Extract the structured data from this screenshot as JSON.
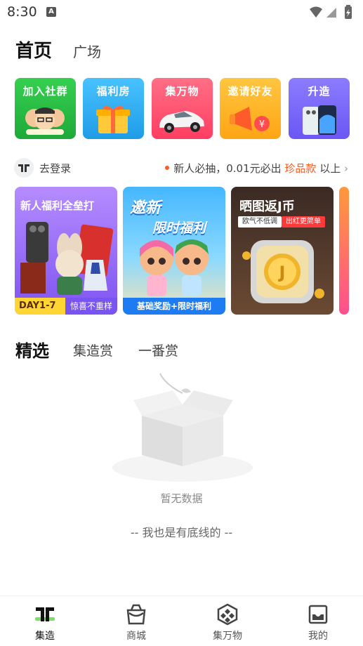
{
  "status_bar": {
    "time": "8:30",
    "notification_icon": "A"
  },
  "top_tabs": [
    {
      "label": "首页",
      "active": true
    },
    {
      "label": "广场",
      "active": false
    }
  ],
  "quick_entries": [
    {
      "label": "加入社群",
      "icon": "people-group-icon",
      "color": "#2fc24a"
    },
    {
      "label": "福利房",
      "icon": "gift-box-icon",
      "color": "#34b0f2"
    },
    {
      "label": "集万物",
      "icon": "sports-car-icon",
      "color": "#ff4f6e"
    },
    {
      "label": "邀请好友",
      "icon": "megaphone-icon",
      "color": "#ffb21f"
    },
    {
      "label": "升造",
      "icon": "phone-icon",
      "color": "#7b6bff"
    }
  ],
  "login_row": {
    "login_text": "去登录",
    "notice_prefix": "新人必抽，0.01元必出",
    "notice_highlight": "珍品款",
    "notice_suffix": "以上"
  },
  "banners": [
    {
      "title": "新人福利全垒打",
      "tag_left": "DAY1-7",
      "tag_right": "惊喜不重样"
    },
    {
      "title": "邀新",
      "subtitle": "限时福利",
      "caption": "基础奖励+限时福利"
    },
    {
      "title": "晒图返J币",
      "pill_left": "欧气不低调",
      "pill_right": "出红更简单"
    }
  ],
  "section_tabs": [
    {
      "label": "精选",
      "active": true
    },
    {
      "label": "集造赏",
      "active": false
    },
    {
      "label": "一番赏",
      "active": false
    }
  ],
  "empty_state": {
    "text": "暂无数据",
    "bottom_line": "-- 我也是有底线的 --"
  },
  "bottom_nav": [
    {
      "label": "集造",
      "icon": "jizao-logo-icon",
      "active": true
    },
    {
      "label": "商城",
      "icon": "shopping-bag-icon",
      "active": false
    },
    {
      "label": "集万物",
      "icon": "diamond-pattern-icon",
      "active": false
    },
    {
      "label": "我的",
      "icon": "profile-tray-icon",
      "active": false
    }
  ],
  "colors": {
    "accent_green": "#7ee06b",
    "highlight_orange": "#ff5a1f"
  }
}
